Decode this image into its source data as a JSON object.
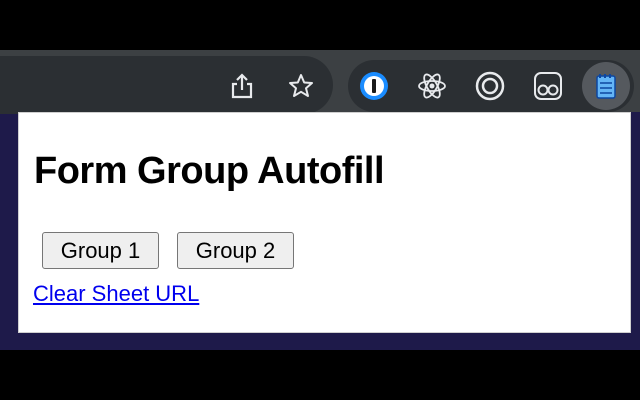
{
  "browser": {
    "toolbar_icons": [
      "share-icon",
      "bookmark-star-icon"
    ],
    "extensions": [
      "1password-icon",
      "react-devtools-icon",
      "extension-ring-icon",
      "extension-glasses-icon",
      "form-group-autofill-icon"
    ]
  },
  "popup": {
    "title": "Form Group Autofill",
    "buttons": [
      {
        "label": "Group 1"
      },
      {
        "label": "Group 2"
      }
    ],
    "clear_link": "Clear Sheet URL"
  },
  "colors": {
    "toolbar": "#3c4043",
    "page_background": "#1e1a4a",
    "link": "#0000ee"
  }
}
